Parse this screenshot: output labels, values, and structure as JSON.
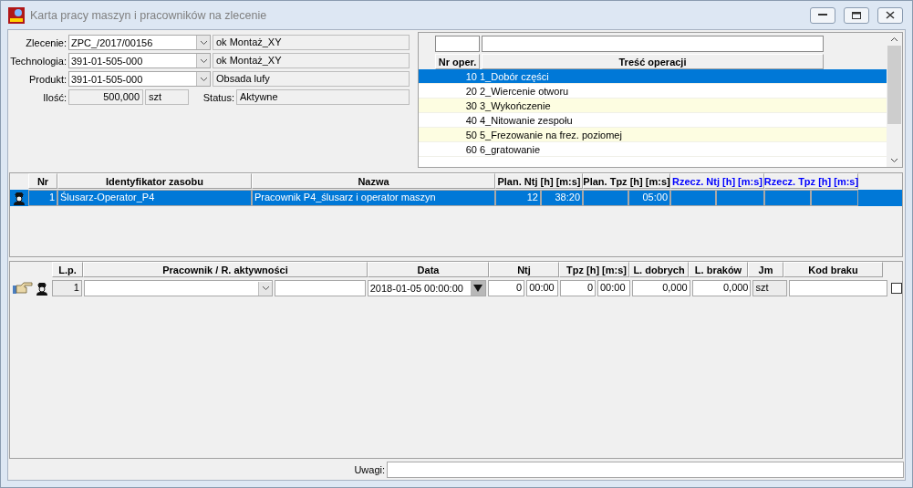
{
  "window": {
    "title": "Karta pracy maszyn i pracowników na zlecenie"
  },
  "form": {
    "fields": [
      {
        "label": "Zlecenie:",
        "value": "ZPC_/2017/00156",
        "description": "ok Montaż_XY"
      },
      {
        "label": "Technologia:",
        "value": "391-01-505-000",
        "description": "ok Montaż_XY"
      },
      {
        "label": "Produkt:",
        "value": "391-01-505-000",
        "description": "Obsada lufy"
      }
    ],
    "quantity": {
      "label": "Ilość:",
      "value": "500,000",
      "unit": "szt"
    },
    "status": {
      "label": "Status:",
      "value": "Aktywne"
    }
  },
  "operations": {
    "columns": [
      "Nr oper.",
      "Treść operacji"
    ],
    "rows": [
      {
        "nr": "10",
        "name": "1_Dobór części",
        "selected": true
      },
      {
        "nr": "20",
        "name": "2_Wiercenie otworu",
        "selected": false
      },
      {
        "nr": "30",
        "name": "3_Wykończenie",
        "selected": false
      },
      {
        "nr": "40",
        "name": "4_Nitowanie zespołu",
        "selected": false
      },
      {
        "nr": "50",
        "name": "5_Frezowanie na frez. poziomej",
        "selected": false
      },
      {
        "nr": "60",
        "name": "6_gratowanie",
        "selected": false
      }
    ]
  },
  "resources": {
    "columns": [
      {
        "label": "Nr",
        "kind": "plain"
      },
      {
        "label": "Identyfikator zasobu",
        "kind": "plain"
      },
      {
        "label": "Nazwa",
        "kind": "plain"
      },
      {
        "label": "**Plan. Ntj** [h] [m:s]",
        "kind": "plan"
      },
      {
        "label": "**Plan. Tpz** [h] [m:s]",
        "kind": "plan"
      },
      {
        "label": "**Rzecz. Ntj** [h] [m:s]",
        "kind": "actual"
      },
      {
        "label": "**Rzecz. Tpz** [h] [m:s]",
        "kind": "actual"
      }
    ],
    "rows": [
      {
        "nr": "1",
        "identifier": "Ślusarz-Operator_P4",
        "name": "Pracownik P4_ślusarz i operator maszyn",
        "plan_ntj_h": "12",
        "plan_ntj_ms": "38:20",
        "plan_tpz_ms": "05:00",
        "selected": true
      }
    ]
  },
  "work": {
    "columns": [
      "L.p.",
      "Pracownik / R. aktywności",
      "Data",
      "Ntj",
      "Tpz [h] [m:s]",
      "L. dobrych",
      "L. braków",
      "Jm",
      "Kod braku"
    ],
    "rows": [
      {
        "lp": "1",
        "date": "2018-01-05 00:00:00",
        "ntj_h": "0",
        "ntj_ms": "00:00",
        "tpz_h": "0",
        "tpz_ms": "00:00",
        "good": "0,000",
        "rejects": "0,000",
        "unit": "szt",
        "checked": false
      }
    ]
  },
  "remarks": {
    "label": "Uwagi:"
  }
}
